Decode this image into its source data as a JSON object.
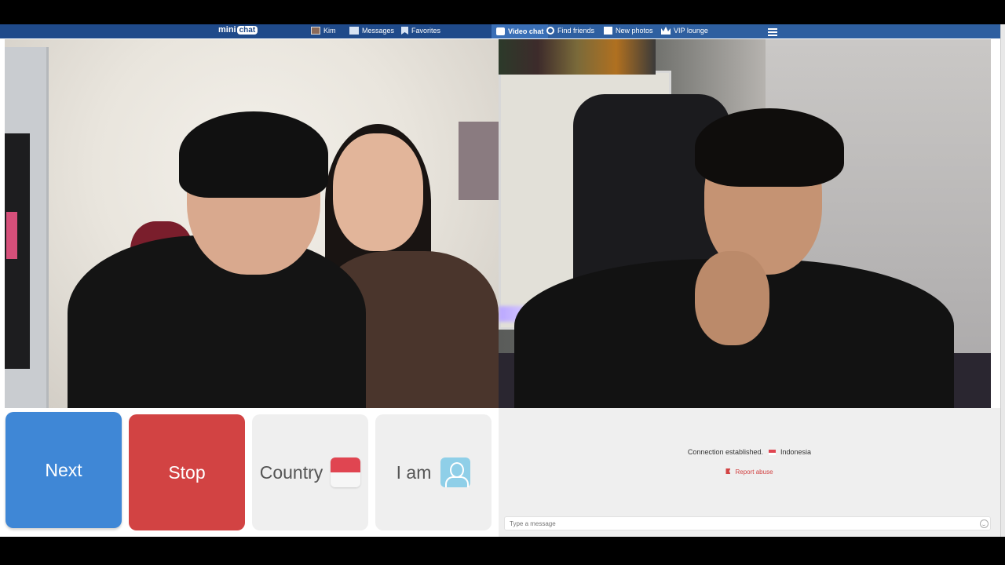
{
  "header": {
    "logo_text": "mini",
    "logo_bubble": "chat",
    "nav_left": [
      {
        "label": "Kim",
        "icon": "avatar-icon"
      },
      {
        "label": "Messages",
        "icon": "envelope-icon"
      },
      {
        "label": "Favorites",
        "icon": "bookmark-icon"
      }
    ],
    "nav_right": [
      {
        "label": "Video chat",
        "icon": "video-chat-icon",
        "active": true
      },
      {
        "label": "Find friends",
        "icon": "search-icon"
      },
      {
        "label": "New photos",
        "icon": "photos-icon"
      },
      {
        "label": "VIP lounge",
        "icon": "crown-icon"
      }
    ],
    "menu_icon": "hamburger-menu-icon"
  },
  "controls": {
    "next_label": "Next",
    "stop_label": "Stop",
    "country_label": "Country",
    "iam_label": "I am"
  },
  "chat": {
    "status_text": "Connection established.",
    "country_name": "Indonesia",
    "report_text": "Report abuse",
    "message_placeholder": "Type a message"
  },
  "colors": {
    "next": "#3f87d6",
    "stop": "#d24343",
    "nav_bg": "#2e5fa0",
    "flag_red": "#e04551"
  }
}
